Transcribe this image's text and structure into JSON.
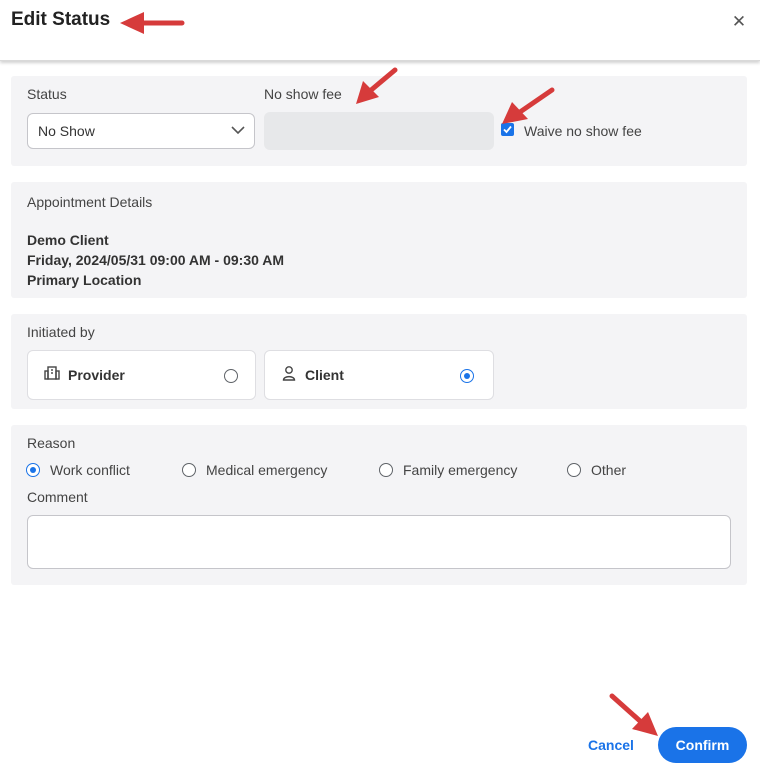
{
  "dialog": {
    "title": "Edit Status",
    "close_glyph": "✕"
  },
  "status_section": {
    "status_label": "Status",
    "status_value": "No Show",
    "fee_label": "No show fee",
    "fee_value": "",
    "waive_checked": true,
    "waive_label": "Waive no show fee"
  },
  "appointment": {
    "heading": "Appointment Details",
    "client": "Demo Client",
    "datetime": "Friday, 2024/05/31 09:00 AM - 09:30 AM",
    "location": "Primary Location"
  },
  "initiated_by": {
    "heading": "Initiated by",
    "options": [
      {
        "label": "Provider",
        "icon": "building-icon",
        "selected": false
      },
      {
        "label": "Client",
        "icon": "person-icon",
        "selected": true
      }
    ]
  },
  "reason": {
    "heading": "Reason",
    "options": [
      {
        "label": "Work conflict",
        "selected": true
      },
      {
        "label": "Medical emergency",
        "selected": false
      },
      {
        "label": "Family emergency",
        "selected": false
      },
      {
        "label": "Other",
        "selected": false
      }
    ],
    "comment_label": "Comment",
    "comment_value": ""
  },
  "footer": {
    "cancel_label": "Cancel",
    "confirm_label": "Confirm"
  },
  "colors": {
    "accent": "#1a73e8",
    "annotation_arrow": "#d63b3b",
    "section_bg": "#f4f4f6"
  }
}
